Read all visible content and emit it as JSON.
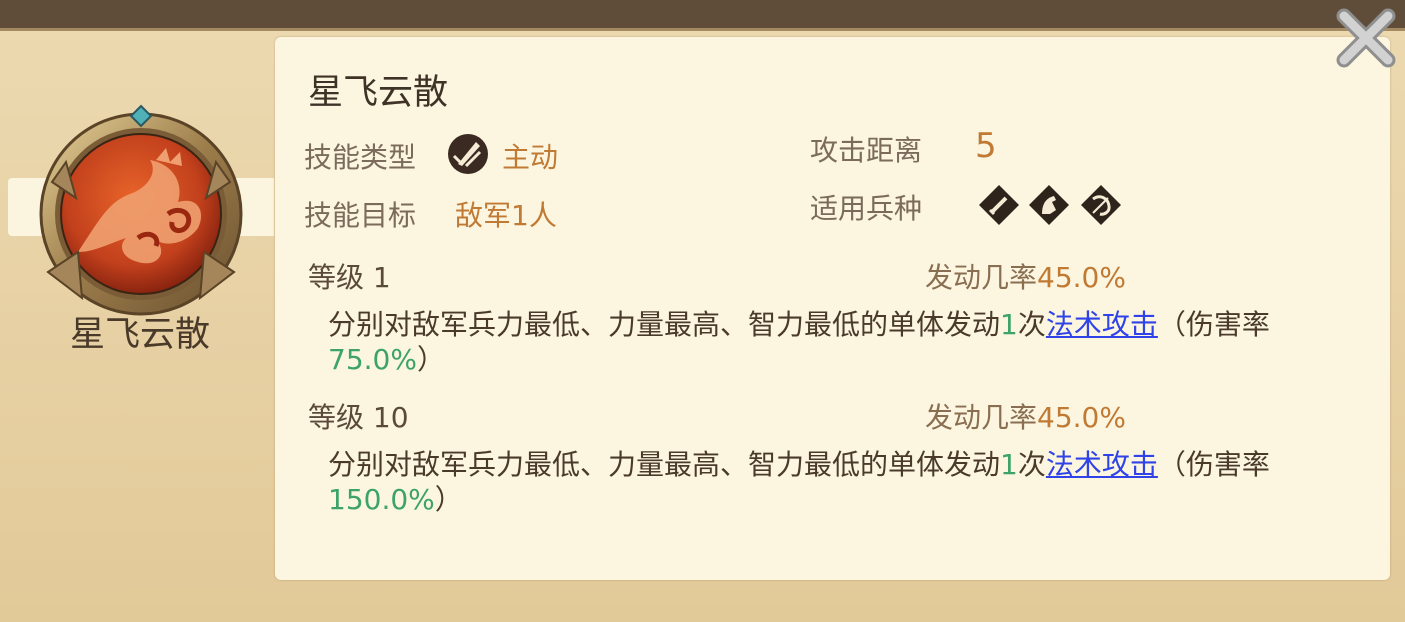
{
  "skill": {
    "name": "星飞云散",
    "name_left": "星飞云散"
  },
  "info": {
    "type_label": "技能类型",
    "type_value": "主动",
    "type_icon": "active-skill-icon",
    "target_label": "技能目标",
    "target_value": "敌军1人",
    "range_label": "攻击距离",
    "range_value": "5",
    "troops_label": "适用兵种",
    "troop_icons": [
      "sword-icon",
      "horse-icon",
      "bow-icon"
    ]
  },
  "levels": [
    {
      "level_label": "等级",
      "level_num": "1",
      "rate_label": "发动几率",
      "rate_value": "45.0%",
      "desc_prefix": "分别对敌军兵力最低、力量最高、智力最低的单体发动",
      "desc_count": "1",
      "desc_mid": "次",
      "desc_link": "法术攻击",
      "desc_suffix_a": "（伤害率",
      "desc_pct": "75.0%",
      "desc_suffix_b": "）"
    },
    {
      "level_label": "等级",
      "level_num": "10",
      "rate_label": "发动几率",
      "rate_value": "45.0%",
      "desc_prefix": "分别对敌军兵力最低、力量最高、智力最低的单体发动",
      "desc_count": "1",
      "desc_mid": "次",
      "desc_link": "法术攻击",
      "desc_suffix_a": "（伤害率",
      "desc_pct": "150.0%",
      "desc_suffix_b": "）"
    }
  ],
  "colors": {
    "accent_orange": "#c07a34",
    "highlight_green": "#3da36a",
    "link_blue": "#2f43e8",
    "badge_red": "#c2401c"
  },
  "close_icon": "close-icon"
}
